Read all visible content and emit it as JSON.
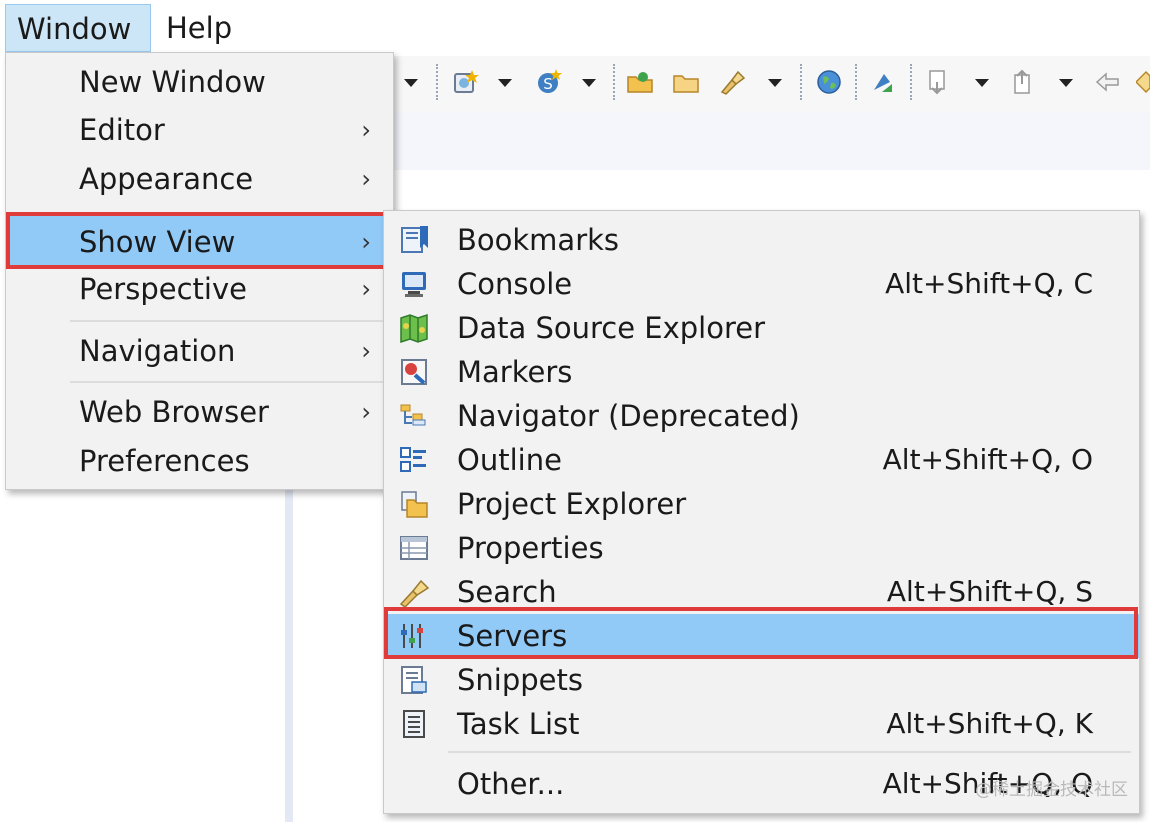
{
  "menubar": {
    "items": [
      {
        "label": "Window"
      },
      {
        "label": "Help"
      }
    ]
  },
  "window_menu": {
    "items": [
      {
        "label": "New Window"
      },
      {
        "label": "Editor",
        "has_submenu": true
      },
      {
        "label": "Appearance",
        "has_submenu": true
      },
      {
        "label": "Show View",
        "has_submenu": true,
        "highlighted": true
      },
      {
        "label": "Perspective",
        "has_submenu": true
      },
      {
        "label": "Navigation",
        "has_submenu": true
      },
      {
        "label": "Web Browser",
        "has_submenu": true
      },
      {
        "label": "Preferences"
      }
    ],
    "submenu_arrow": "›"
  },
  "show_view_menu": {
    "items": [
      {
        "label": "Bookmarks",
        "shortcut": "",
        "icon": "bookmarks-icon"
      },
      {
        "label": "Console",
        "shortcut": "Alt+Shift+Q, C",
        "icon": "console-icon"
      },
      {
        "label": "Data Source Explorer",
        "shortcut": "",
        "icon": "data-source-explorer-icon"
      },
      {
        "label": "Markers",
        "shortcut": "",
        "icon": "markers-icon"
      },
      {
        "label": "Navigator (Deprecated)",
        "shortcut": "",
        "icon": "navigator-icon"
      },
      {
        "label": "Outline",
        "shortcut": "Alt+Shift+Q, O",
        "icon": "outline-icon"
      },
      {
        "label": "Project Explorer",
        "shortcut": "",
        "icon": "project-explorer-icon"
      },
      {
        "label": "Properties",
        "shortcut": "",
        "icon": "properties-icon"
      },
      {
        "label": "Search",
        "shortcut": "Alt+Shift+Q, S",
        "icon": "search-icon"
      },
      {
        "label": "Servers",
        "shortcut": "",
        "icon": "servers-icon",
        "highlighted": true
      },
      {
        "label": "Snippets",
        "shortcut": "",
        "icon": "snippets-icon"
      },
      {
        "label": "Task List",
        "shortcut": "Alt+Shift+Q, K",
        "icon": "task-list-icon"
      },
      {
        "label": "Other...",
        "shortcut": "Alt+Shift+Q, Q",
        "icon": ""
      }
    ]
  },
  "watermark": "@稀土掘金技术社区",
  "colors": {
    "highlight": "#91c9f7",
    "annotation_box": "#e03b3b",
    "menubar_active": "#cde6f7"
  }
}
